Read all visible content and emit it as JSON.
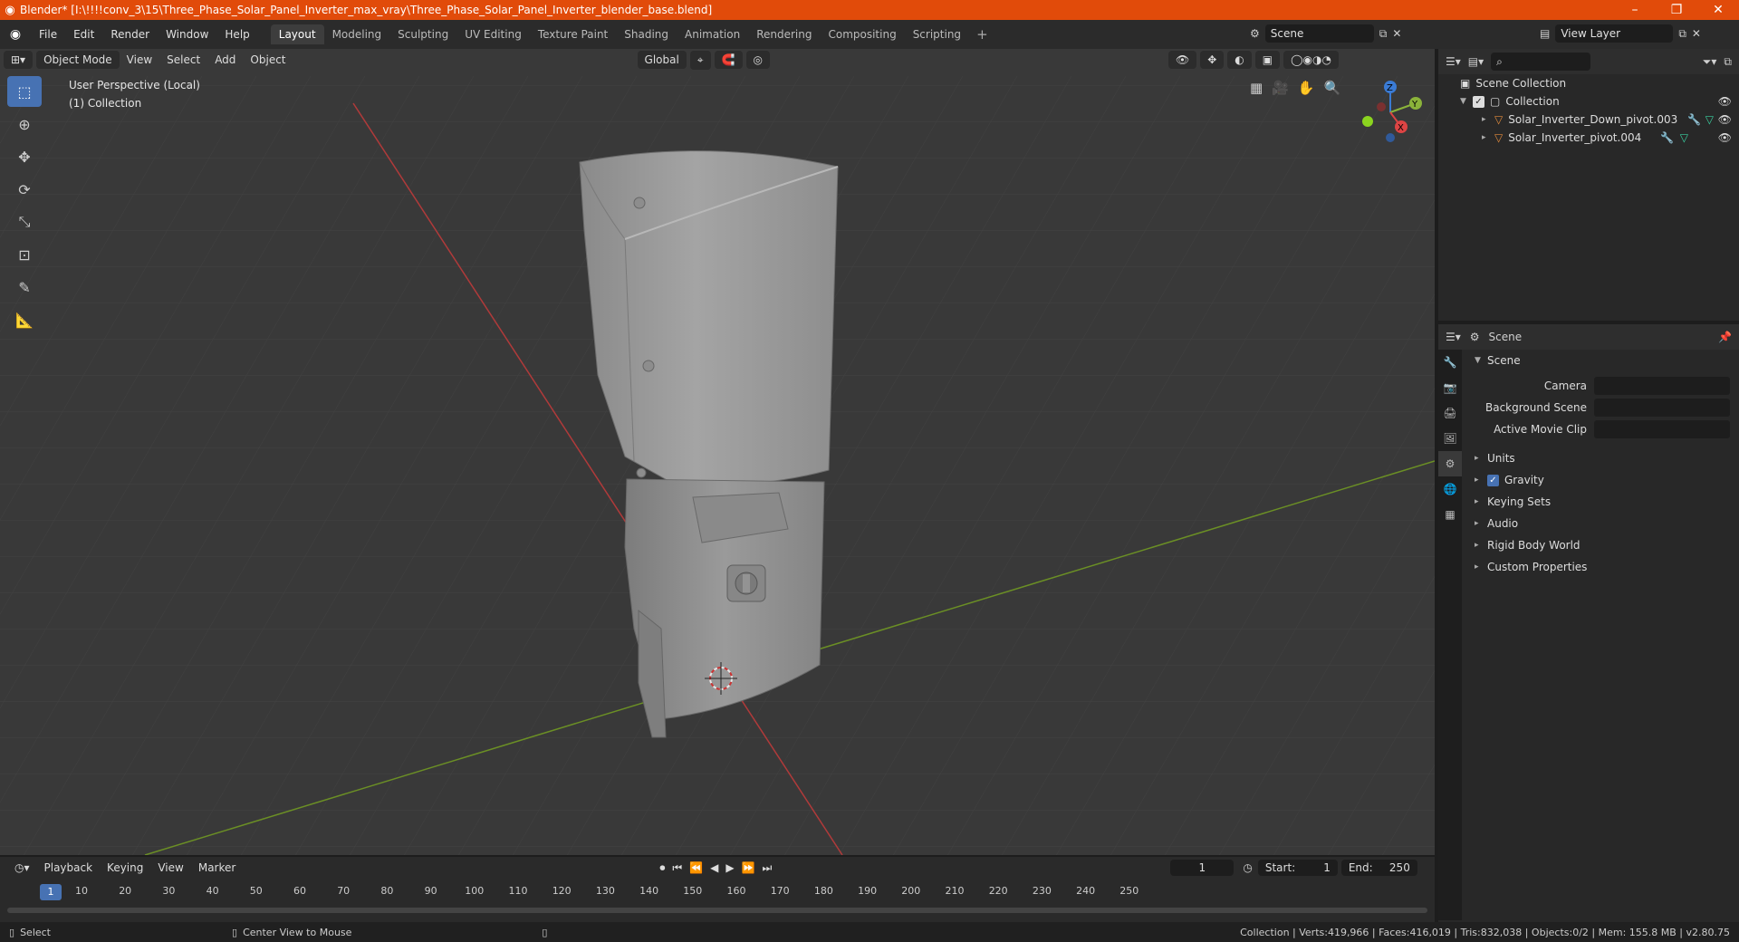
{
  "window": {
    "title": "Blender* [I:\\!!!!conv_3\\15\\Three_Phase_Solar_Panel_Inverter_max_vray\\Three_Phase_Solar_Panel_Inverter_blender_base.blend]",
    "minimize": "–",
    "maximize": "❐",
    "close": "✕"
  },
  "menubar": {
    "items": [
      "File",
      "Edit",
      "Render",
      "Window",
      "Help"
    ],
    "workspaces": [
      "Layout",
      "Modeling",
      "Sculpting",
      "UV Editing",
      "Texture Paint",
      "Shading",
      "Animation",
      "Rendering",
      "Compositing",
      "Scripting"
    ],
    "active_workspace": "Layout",
    "add_workspace": "+",
    "scene": "Scene",
    "view_layer": "View Layer"
  },
  "viewport": {
    "mode": "Object Mode",
    "menus": [
      "View",
      "Select",
      "Add",
      "Object"
    ],
    "transform_orientation": "Global",
    "info_line1": "User Perspective (Local)",
    "info_line2": "(1) Collection",
    "axes": {
      "x": "X",
      "y": "Y",
      "z": "Z"
    }
  },
  "outliner": {
    "root": "Scene Collection",
    "collection": "Collection",
    "objects": [
      {
        "name": "Solar_Inverter_Down_pivot.003"
      },
      {
        "name": "Solar_Inverter_pivot.004"
      }
    ]
  },
  "properties": {
    "header": "Scene",
    "section": "Scene",
    "fields": [
      {
        "label": "Camera",
        "value": ""
      },
      {
        "label": "Background Scene",
        "value": ""
      },
      {
        "label": "Active Movie Clip",
        "value": ""
      }
    ],
    "panels": [
      {
        "label": "Units",
        "checkbox": false
      },
      {
        "label": "Gravity",
        "checkbox": true
      },
      {
        "label": "Keying Sets",
        "checkbox": false
      },
      {
        "label": "Audio",
        "checkbox": false
      },
      {
        "label": "Rigid Body World",
        "checkbox": false
      },
      {
        "label": "Custom Properties",
        "checkbox": false
      }
    ]
  },
  "timeline": {
    "menus": [
      "Playback",
      "Keying",
      "View",
      "Marker"
    ],
    "current_frame": "1",
    "start_label": "Start:",
    "start": "1",
    "end_label": "End:",
    "end": "250",
    "ruler": [
      "10",
      "20",
      "30",
      "40",
      "50",
      "60",
      "70",
      "80",
      "90",
      "100",
      "110",
      "120",
      "130",
      "140",
      "150",
      "160",
      "170",
      "180",
      "190",
      "200",
      "210",
      "220",
      "230",
      "240",
      "250"
    ],
    "ruler_current": "1"
  },
  "statusbar": {
    "left": "Select",
    "middle": "Center View to Mouse",
    "right": "Collection | Verts:419,966 | Faces:416,019 | Tris:832,038 | Objects:0/2 | Mem: 155.8 MB | v2.80.75"
  }
}
